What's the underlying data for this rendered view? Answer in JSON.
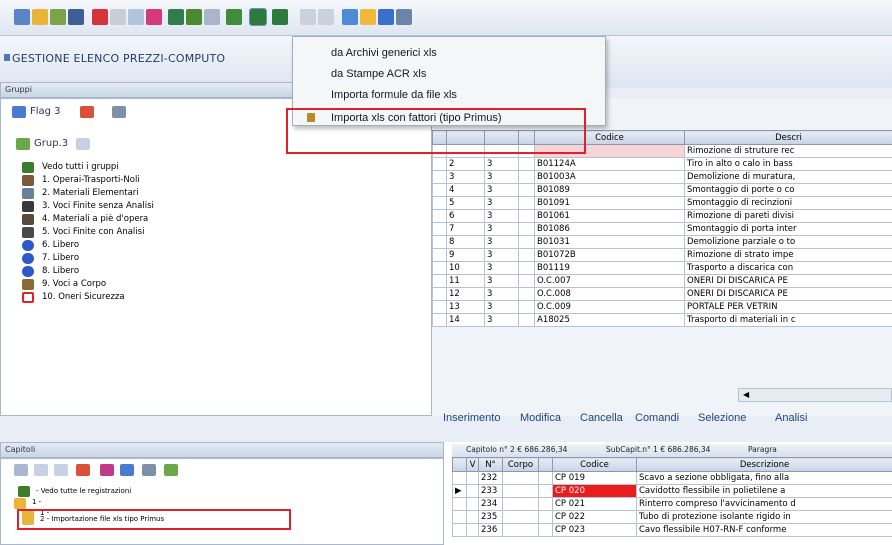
{
  "app_title": "GESTIONE ELENCO PREZZI-COMPUTO",
  "menu": {
    "items": [
      "da Archivi generici xls",
      "da Stampe ACR xls",
      "Importa formule da file xls",
      "Importa xls con fattori (tipo Primus)"
    ]
  },
  "gruppi": {
    "header": "Gruppi",
    "flag_label": "Flag 3",
    "grup_label": "Grup.3",
    "tree": [
      "Vedo tutti i gruppi",
      "1. Operai-Trasporti-Noli",
      "2. Materiali Elementari",
      "3. Voci Finite senza Analisi",
      "4. Materiali a piè d'opera",
      "5. Voci Finite con Analisi",
      "6. Libero",
      "7. Libero",
      "8. Libero",
      "9. Voci a Corpo",
      "10. Oneri Sicurezza"
    ]
  },
  "main_grid": {
    "col_codice": "Codice",
    "col_descr": "Descri",
    "rows": [
      {
        "n": "",
        "g": "",
        "codice": "",
        "descr": "Rimozione di struture rec"
      },
      {
        "n": "2",
        "g": "3",
        "codice": "B01124A",
        "descr": "Tiro in alto o calo in bass"
      },
      {
        "n": "3",
        "g": "3",
        "codice": "B01003A",
        "descr": "Demolizione di muratura,"
      },
      {
        "n": "4",
        "g": "3",
        "codice": "B01089",
        "descr": "Smontaggio di porte o co"
      },
      {
        "n": "5",
        "g": "3",
        "codice": "B01091",
        "descr": "Smontaggio di recinzioni"
      },
      {
        "n": "6",
        "g": "3",
        "codice": "B01061",
        "descr": "Rimozione di pareti divisi"
      },
      {
        "n": "7",
        "g": "3",
        "codice": "B01086",
        "descr": "Smontaggio di porta inter"
      },
      {
        "n": "8",
        "g": "3",
        "codice": "B01031",
        "descr": "Demolizione parziale o to"
      },
      {
        "n": "9",
        "g": "3",
        "codice": "B01072B",
        "descr": "Rimozione di strato impe"
      },
      {
        "n": "10",
        "g": "3",
        "codice": "B01119",
        "descr": "Trasporto a discarica con"
      },
      {
        "n": "11",
        "g": "3",
        "codice": "O.C.007",
        "descr": "ONERI DI DISCARICA PE"
      },
      {
        "n": "12",
        "g": "3",
        "codice": "O.C.008",
        "descr": "ONERI DI DISCARICA PE"
      },
      {
        "n": "13",
        "g": "3",
        "codice": "O.C.009",
        "descr": "PORTALE PER VETRIN"
      },
      {
        "n": "14",
        "g": "3",
        "codice": "A18025",
        "descr": "Trasporto di materiali in c"
      }
    ]
  },
  "tabs": [
    "Inserimento",
    "Modifica",
    "Cancella",
    "Comandi",
    "Selezione",
    "Analisi"
  ],
  "capitoli": {
    "header": "Capitoli",
    "tree": [
      "- Vedo tutte le registrazioni",
      "1 -",
      "1 -",
      "2 - Importazione file xls tipo Primus"
    ]
  },
  "bottom_grid": {
    "capitolo": "Capitolo n° 2 € 686.286,34",
    "subcap": "SubCapit.n° 1 € 686.286,34",
    "parag": "Paragra",
    "headers": {
      "v": "V",
      "n": "N°",
      "corpo": "Corpo",
      "codice": "Codice",
      "descr": "Descrizione"
    },
    "rows": [
      {
        "n": "232",
        "codice": "CP 019",
        "descr": "Scavo a sezione obbligata, fino alla"
      },
      {
        "n": "233",
        "codice": "CP 020",
        "descr": "Cavidotto flessibile in polietilene a"
      },
      {
        "n": "234",
        "codice": "CP 021",
        "descr": "Rinterro compreso l'avvicinamento d"
      },
      {
        "n": "235",
        "codice": "CP 022",
        "descr": "Tubo di protezione isolante rigido in"
      },
      {
        "n": "236",
        "codice": "CP 023",
        "descr": "Cavo flessibile H07-RN-F conforme"
      }
    ]
  }
}
